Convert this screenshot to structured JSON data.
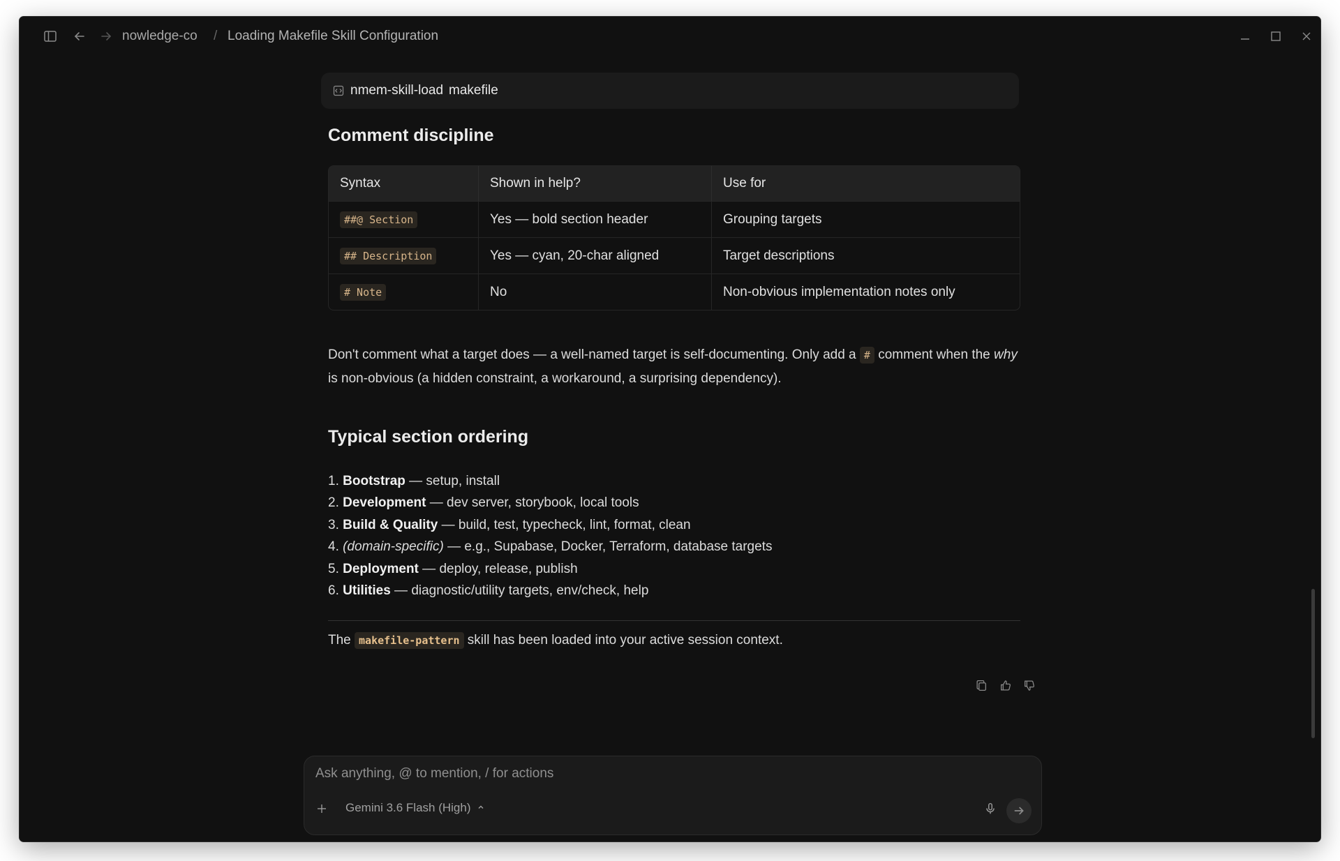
{
  "breadcrumb": {
    "workspace": "nowledge-co",
    "separator": "/",
    "page": "Loading Makefile Skill Configuration"
  },
  "tool_call": {
    "name": "nmem-skill-load",
    "argument": "makefile"
  },
  "section1": {
    "heading": "Comment discipline",
    "table": {
      "headers": [
        "Syntax",
        "Shown in help?",
        "Use for"
      ],
      "rows": [
        {
          "syntax": "##@ Section",
          "shown": "Yes — bold section header",
          "use": "Grouping targets"
        },
        {
          "syntax": "## Description",
          "shown": "Yes — cyan, 20-char aligned",
          "use": "Target descriptions"
        },
        {
          "syntax": "# Note",
          "shown": "No",
          "use": "Non-obvious implementation notes only"
        }
      ]
    },
    "paragraph": {
      "part1": "Don't comment what a target does — a well-named target is self-documenting. Only add a ",
      "code": "#",
      "part2": " comment when the ",
      "emphasis": "why",
      "part3": " is non-obvious (a hidden constraint, a workaround, a surprising dependency)."
    }
  },
  "section2": {
    "heading": "Typical section ordering",
    "items": [
      {
        "num": "1.",
        "bold": "Bootstrap",
        "italic": "",
        "rest": " — setup, install"
      },
      {
        "num": "2.",
        "bold": "Development",
        "italic": "",
        "rest": " — dev server, storybook, local tools"
      },
      {
        "num": "3.",
        "bold": "Build & Quality",
        "italic": "",
        "rest": " — build, test, typecheck, lint, format, clean"
      },
      {
        "num": "4.",
        "bold": "",
        "italic": "(domain-specific)",
        "rest": " — e.g., Supabase, Docker, Terraform, database targets"
      },
      {
        "num": "5.",
        "bold": "Deployment",
        "italic": "",
        "rest": " — deploy, release, publish"
      },
      {
        "num": "6.",
        "bold": "Utilities",
        "italic": "",
        "rest": " — diagnostic/utility targets, env/check, help"
      }
    ]
  },
  "final_message": {
    "prefix": "The ",
    "code": "makefile-pattern",
    "suffix": " skill has been loaded into your active session context."
  },
  "composer": {
    "placeholder": "Ask anything, @ to mention, / for actions",
    "model": "Gemini 3.6 Flash (High)"
  },
  "colors": {
    "background": "#111111",
    "surface": "#1b1b1b",
    "code_text": "#d7b58a"
  }
}
